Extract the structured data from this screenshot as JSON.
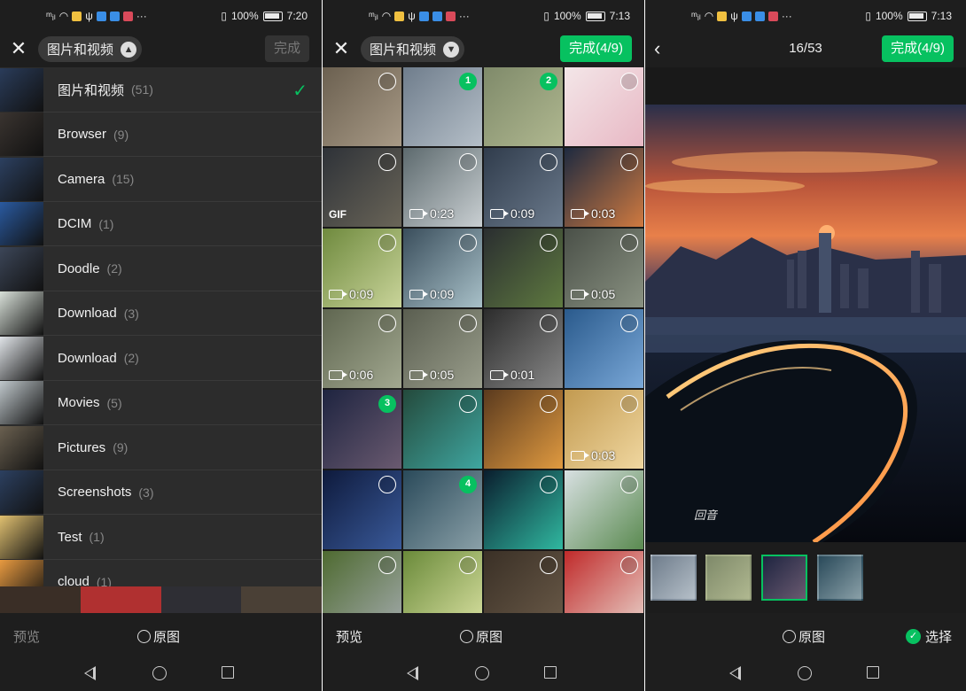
{
  "status": {
    "p1_time": "7:20",
    "p2_time": "7:13",
    "p3_time": "7:13",
    "battery": "100%"
  },
  "panel1": {
    "current_album": "图片和视频",
    "done_label": "完成",
    "albums": [
      {
        "label": "图片和视频",
        "count": "(51)",
        "selected": true
      },
      {
        "label": "Browser",
        "count": "(9)"
      },
      {
        "label": "Camera",
        "count": "(15)"
      },
      {
        "label": "DCIM",
        "count": "(1)"
      },
      {
        "label": "Doodle",
        "count": "(2)"
      },
      {
        "label": "Download",
        "count": "(3)"
      },
      {
        "label": "Download",
        "count": "(2)"
      },
      {
        "label": "Movies",
        "count": "(5)"
      },
      {
        "label": "Pictures",
        "count": "(9)"
      },
      {
        "label": "Screenshots",
        "count": "(3)"
      },
      {
        "label": "Test",
        "count": "(1)"
      },
      {
        "label": "cloud",
        "count": "(1)"
      }
    ],
    "preview_label": "预览",
    "original_label": "原图"
  },
  "panel2": {
    "current_album": "图片和视频",
    "done_label": "完成(4/9)",
    "preview_label": "预览",
    "original_label": "原图",
    "grid": [
      {
        "c": "#6b6050",
        "c2": "#a89a86"
      },
      {
        "c": "#6f7d8c",
        "c2": "#b5bfc8",
        "n": "1"
      },
      {
        "c": "#7f8a6a",
        "c2": "#b0b890",
        "n": "2"
      },
      {
        "c": "#f3e6e8",
        "c2": "#e8b8c4"
      },
      {
        "c": "#2e3238",
        "c2": "#6a6558",
        "gif": "GIF"
      },
      {
        "c": "#5d6a6e",
        "c2": "#c9cfd2",
        "d": "0:23"
      },
      {
        "c": "#303c4c",
        "c2": "#6b7a8c",
        "d": "0:09"
      },
      {
        "c": "#1e2a40",
        "c2": "#d07a40",
        "d": "0:03"
      },
      {
        "c": "#6f8a3e",
        "c2": "#c9d49a",
        "d": "0:09"
      },
      {
        "c": "#3a4e5c",
        "c2": "#a8c0c8",
        "d": "0:09"
      },
      {
        "c": "#2a2e30",
        "c2": "#5f7a40"
      },
      {
        "c": "#4a5048",
        "c2": "#8a9282",
        "d": "0:05"
      },
      {
        "c": "#5f6650",
        "c2": "#a2a890",
        "d": "0:06"
      },
      {
        "c": "#5a5e50",
        "c2": "#9a9e8c",
        "d": "0:05"
      },
      {
        "c": "#2c2c2c",
        "c2": "#888888",
        "d": "0:01"
      },
      {
        "c": "#2a5a8c",
        "c2": "#7aa8d8"
      },
      {
        "c": "#1e2440",
        "c2": "#6a5a70",
        "n": "3"
      },
      {
        "c": "#244a3c",
        "c2": "#3fa6a0"
      },
      {
        "c": "#5a3a1e",
        "c2": "#e09a40"
      },
      {
        "c": "#c29a50",
        "c2": "#f0d7a0",
        "d": "0:03"
      },
      {
        "c": "#0e1a3c",
        "c2": "#3a5a9a"
      },
      {
        "c": "#2a4a5a",
        "c2": "#8aa0a8",
        "n": "4"
      },
      {
        "c": "#0a1e2e",
        "c2": "#30b8a0"
      },
      {
        "c": "#d8e0e2",
        "c2": "#5a8a50"
      },
      {
        "c": "#4e6a30",
        "c2": "#a0a8a8"
      },
      {
        "c": "#6a8a3a",
        "c2": "#d8e0a0"
      },
      {
        "c": "#3a3026",
        "c2": "#6a5a48"
      },
      {
        "c": "#c02a2a",
        "c2": "#e8d0c8"
      }
    ]
  },
  "panel3": {
    "counter": "16/53",
    "done_label": "完成(4/9)",
    "original_label": "原图",
    "select_label": "选择",
    "signature": "回音"
  }
}
